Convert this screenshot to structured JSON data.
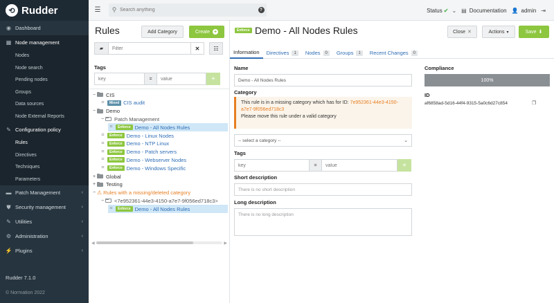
{
  "app": {
    "name": "Rudder",
    "version": "Rudder 7.1.0",
    "copyright": "© Normation 2022"
  },
  "sidebar": {
    "items": [
      {
        "label": "Dashboard"
      },
      {
        "label": "Node management",
        "sub": [
          "Nodes",
          "Node search",
          "Pending nodes",
          "Groups",
          "Data sources",
          "Node External Reports"
        ]
      },
      {
        "label": "Configuration policy",
        "sub": [
          "Rules",
          "Directives",
          "Techniques",
          "Parameters"
        ]
      },
      {
        "label": "Patch Management"
      },
      {
        "label": "Security management"
      },
      {
        "label": "Utilities"
      },
      {
        "label": "Administration"
      },
      {
        "label": "Plugins"
      }
    ]
  },
  "topbar": {
    "search_placeholder": "Search anything",
    "status_label": "Status",
    "documentation_label": "Documentation",
    "user_label": "admin"
  },
  "rules_panel": {
    "title": "Rules",
    "add_category_label": "Add Category",
    "create_label": "Create",
    "filter_placeholder": "Filter",
    "tags_label": "Tags",
    "tag_key_placeholder": "key",
    "tag_eq": "=",
    "tag_value_placeholder": "value"
  },
  "tree": [
    {
      "type": "category",
      "label": "CIS",
      "open": true
    },
    {
      "type": "rule",
      "badge": "Mixed",
      "label": "CIS audit"
    },
    {
      "type": "category",
      "label": "Demo",
      "open": true
    },
    {
      "type": "category",
      "label": "Patch Management",
      "open": true
    },
    {
      "type": "rule",
      "badge": "Enforce",
      "label": "Demo - All Nodes Rules",
      "selected": true
    },
    {
      "type": "rule",
      "badge": "Enforce",
      "label": "Demo - Linux Nodes"
    },
    {
      "type": "rule",
      "badge": "Enforce",
      "label": "Demo - NTP Linux"
    },
    {
      "type": "rule",
      "badge": "Enforce",
      "label": "Demo - Patch servers"
    },
    {
      "type": "rule",
      "badge": "Enforce",
      "label": "Demo - Webserver Nodes"
    },
    {
      "type": "rule",
      "badge": "Enforce",
      "label": "Demo - Windows Specific"
    },
    {
      "type": "category",
      "label": "Global",
      "open": false
    },
    {
      "type": "category",
      "label": "Testing",
      "open": false
    },
    {
      "type": "category",
      "label": "Rules with a missing/deleted category",
      "open": true,
      "warning": true
    },
    {
      "type": "category",
      "label": "<7e952361-44e3-4150-a7e7-9f056ed718c3>",
      "open": true
    },
    {
      "type": "rule",
      "badge": "Enforce",
      "label": "Demo - All Nodes Rules",
      "selected": true
    }
  ],
  "detail": {
    "badge": "Enforce",
    "title": "Demo - All Nodes Rules",
    "close_label": "Close",
    "actions_label": "Actions",
    "save_label": "Save",
    "tabs": [
      {
        "label": "Information",
        "count": ""
      },
      {
        "label": "Directives",
        "count": "1"
      },
      {
        "label": "Nodes",
        "count": "0"
      },
      {
        "label": "Groups",
        "count": "1"
      },
      {
        "label": "Recent Changes",
        "count": "0"
      }
    ],
    "name_label": "Name",
    "name_value": "Demo - All Nodes Rules",
    "category_label": "Category",
    "alert_text_1": "This rule is in a missing category which has for ID: ",
    "alert_uuid": "7e952361-44e3-4150-a7e7-9f056ed718c3",
    "alert_text_2": "Please move this rule under a valid category",
    "category_select": "-- select a category --",
    "tags_label": "Tags",
    "tag_key_placeholder": "key",
    "tag_eq": "=",
    "tag_value_placeholder": "value",
    "short_desc_label": "Short description",
    "short_desc_placeholder": "There is no short description",
    "long_desc_label": "Long description",
    "long_desc_placeholder": "There is no long description",
    "compliance_label": "Compliance",
    "compliance_value": "100%",
    "id_label": "ID",
    "id_value": "af6858ad-5d16-44f4-9315-5a0c6d27c854"
  },
  "colors": {
    "sidebar_bg": "#26343f",
    "accent_green": "#8dc63f",
    "link_blue": "#2f6db5",
    "warning_orange": "#e67e22"
  }
}
